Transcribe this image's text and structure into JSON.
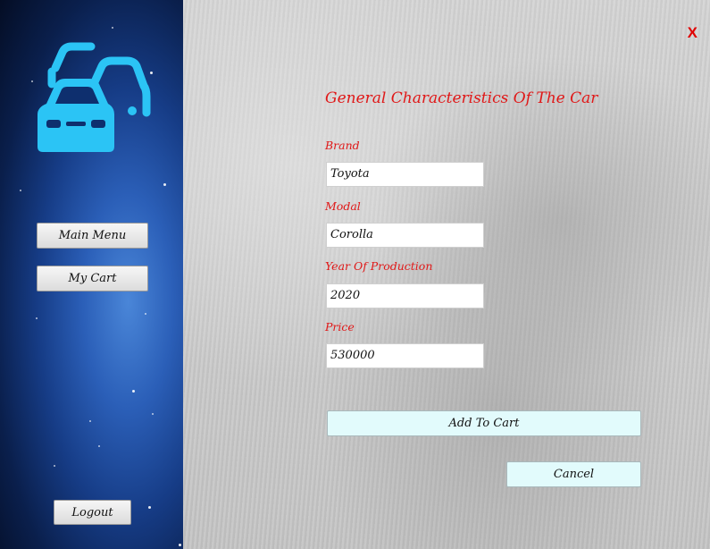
{
  "sidebar": {
    "main_menu_label": "Main Menu",
    "my_cart_label": "My Cart",
    "logout_label": "Logout",
    "logo_icon": "cars-icon"
  },
  "window": {
    "close_label": "X"
  },
  "form": {
    "heading": "General Characteristics Of The Car",
    "brand_label": "Brand",
    "brand_value": "Toyota",
    "model_label": "Modal",
    "model_value": "Corolla",
    "year_label": "Year Of Production",
    "year_value": "2020",
    "price_label": "Price",
    "price_value": "530000",
    "add_to_cart_label": "Add To Cart",
    "cancel_label": "Cancel"
  },
  "colors": {
    "accent_red": "#e01818",
    "logo_cyan": "#2bc4f5",
    "button_cyan": "#e2fbfc"
  }
}
